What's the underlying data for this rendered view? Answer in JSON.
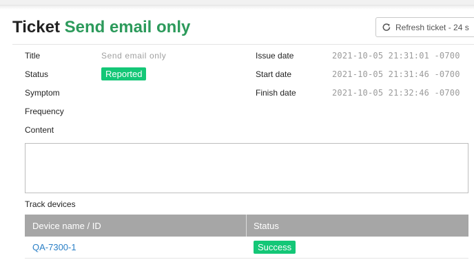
{
  "ticket": {
    "title_prefix": "Ticket",
    "title_name": "Send email only",
    "refresh_label": "Refresh ticket - 24 s",
    "refresh_icon": "refresh-icon"
  },
  "details": {
    "title_label": "Title",
    "title_value": "Send email only",
    "status_label": "Status",
    "status_value": "Reported",
    "symptom_label": "Symptom",
    "frequency_label": "Frequency",
    "content_label": "Content",
    "issue_date_label": "Issue date",
    "issue_date_value": "2021-10-05 21:31:01 -0700",
    "start_date_label": "Start date",
    "start_date_value": "2021-10-05 21:31:46 -0700",
    "finish_date_label": "Finish date",
    "finish_date_value": "2021-10-05 21:32:46 -0700",
    "content_value": ""
  },
  "devices": {
    "section_label": "Track devices",
    "headers": [
      "Device name / ID",
      "Status"
    ],
    "rows": [
      {
        "device": "QA-7300-1",
        "status": "Success"
      }
    ]
  },
  "colors": {
    "accent_green": "#2c9a5b",
    "badge_green": "#14c777",
    "link_blue": "#2a7fc6",
    "table_header": "#a6a6a6"
  }
}
